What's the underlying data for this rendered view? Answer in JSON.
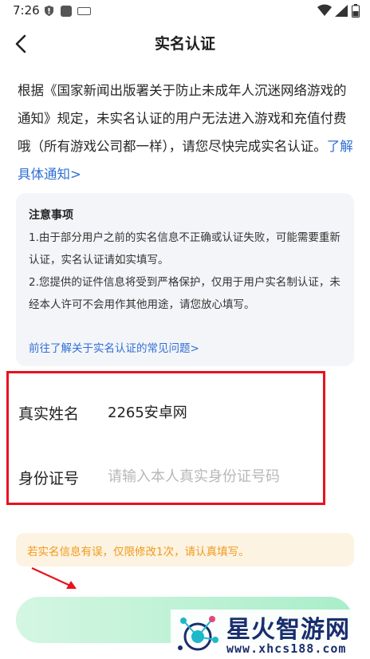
{
  "status_bar": {
    "time": "7:26",
    "icons": [
      "shield-icon",
      "app-square-icon",
      "keyboard-icon",
      "wifi-icon",
      "signal-icon",
      "battery-icon"
    ]
  },
  "header": {
    "title": "实名认证",
    "back_icon": "chevron-left-icon"
  },
  "intro": {
    "text": "根据《国家新闻出版署关于防止未成年人沉迷网络游戏的通知》规定，未实名认证的用户无法进入游戏和充值付费哦（所有游戏公司都一样），请您尽快完成实名认证。",
    "link": "了解具体通知>"
  },
  "notice": {
    "title": "注意事项",
    "items": [
      "1.由于部分用户之前的实名信息不正确或认证失败，可能需要重新认证，实名认证请如实填写。",
      "2.您提供的证件信息将受到严格保护，仅用于用户实名制认证，未经本人许可不会用作其他用途，请您放心填写。"
    ],
    "link": "前往了解关于实名认证的常见问题>"
  },
  "form": {
    "name_label": "真实姓名",
    "name_value": "2265安卓网",
    "id_label": "身份证号",
    "id_placeholder": "请输入本人真实身份证号码",
    "id_value": ""
  },
  "warning": {
    "text": "若实名信息有误，仅限修改1次，请认真填写。"
  },
  "watermark": {
    "brand": "星火智游网",
    "domain": "www.xhcs188.com"
  },
  "colors": {
    "link": "#2f6fd6",
    "highlight_border": "#e8121e",
    "warning_text": "#f09a1a",
    "warning_bg": "#fdf3e2",
    "button_gradient_start": "#d4f6e2",
    "button_gradient_end": "#a9eec9",
    "watermark": "#1a2e6e"
  }
}
